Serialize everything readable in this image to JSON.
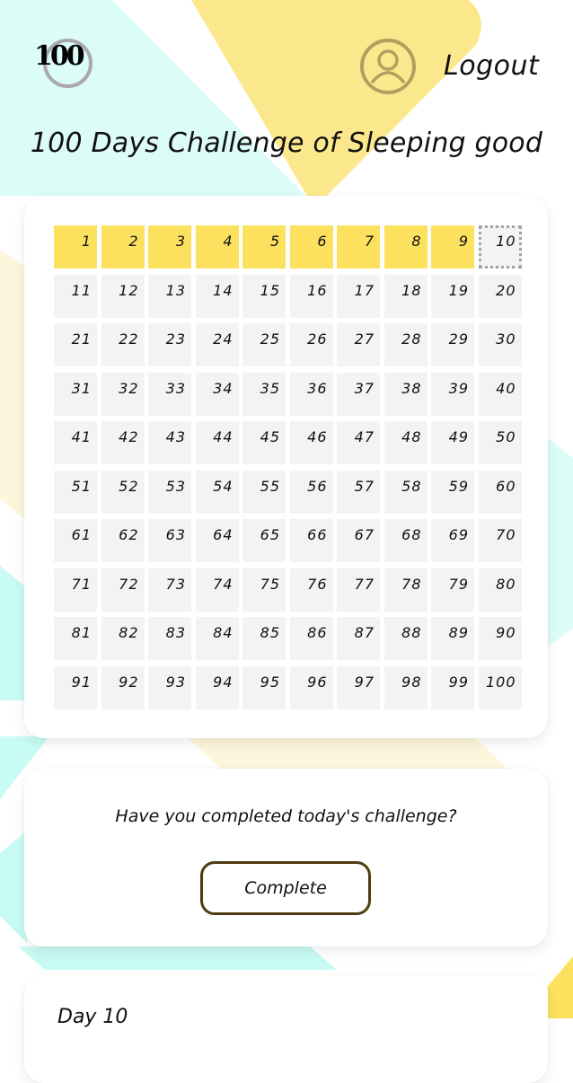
{
  "header": {
    "logo_text": "100",
    "avatar_icon": "user-profile-icon",
    "logout_label": "Logout"
  },
  "page_title": "100 Days Challenge of Sleeping good",
  "colors": {
    "completed_day": "#fbe15e",
    "pending_day": "#f3f3f3",
    "today_border": "#a3a3a3",
    "button_border": "#4d3c10",
    "bg_mint": "#dcfcf8",
    "bg_yellow": "#fce88c"
  },
  "challenge": {
    "total_days": 100,
    "completed_days": 9,
    "current_day": 10,
    "days": [
      "1",
      "2",
      "3",
      "4",
      "5",
      "6",
      "7",
      "8",
      "9",
      "10",
      "11",
      "12",
      "13",
      "14",
      "15",
      "16",
      "17",
      "18",
      "19",
      "20",
      "21",
      "22",
      "23",
      "24",
      "25",
      "26",
      "27",
      "28",
      "29",
      "30",
      "31",
      "32",
      "33",
      "34",
      "35",
      "36",
      "37",
      "38",
      "39",
      "40",
      "41",
      "42",
      "43",
      "44",
      "45",
      "46",
      "47",
      "48",
      "49",
      "50",
      "51",
      "52",
      "53",
      "54",
      "55",
      "56",
      "57",
      "58",
      "59",
      "60",
      "61",
      "62",
      "63",
      "64",
      "65",
      "66",
      "67",
      "68",
      "69",
      "70",
      "71",
      "72",
      "73",
      "74",
      "75",
      "76",
      "77",
      "78",
      "79",
      "80",
      "81",
      "82",
      "83",
      "84",
      "85",
      "86",
      "87",
      "88",
      "89",
      "90",
      "91",
      "92",
      "93",
      "94",
      "95",
      "96",
      "97",
      "98",
      "99",
      "100"
    ]
  },
  "today_prompt": {
    "question": "Have you completed today's challenge?",
    "button_label": "Complete"
  },
  "day_card": {
    "label": "Day 10"
  }
}
